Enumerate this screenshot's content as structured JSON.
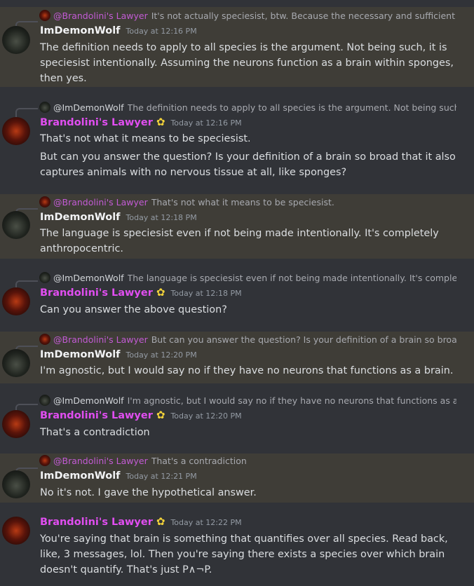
{
  "messages": [
    {
      "author": "ImDemonWolf",
      "time": "Today at 12:16 PM",
      "reply": {
        "name": "@Brandolini's Lawyer",
        "text": "It's not actually speciesist, btw. Because the necessary and sufficient cond"
      },
      "paragraphs": [
        "The definition needs to apply to all species is the argument. Not being such, it is speciesist intentionally. Assuming the neurons function as a brain within sponges, then yes."
      ]
    },
    {
      "author": "Brandolini's Lawyer",
      "time": "Today at 12:16 PM",
      "reply": {
        "name": "@ImDemonWolf",
        "text": "The definition needs to apply to all species is the argument. Not being such, it is"
      },
      "paragraphs": [
        "That's not what it means to be speciesist.",
        "But can you answer the question? Is your definition of a brain so broad that it also captures animals with no nervous tissue at all, like sponges?"
      ]
    },
    {
      "author": "ImDemonWolf",
      "time": "Today at 12:18 PM",
      "reply": {
        "name": "@Brandolini's Lawyer",
        "text": "That's not what it means to be speciesist."
      },
      "paragraphs": [
        "The language is speciesist even if not being made intentionally. It's completely anthropocentric."
      ]
    },
    {
      "author": "Brandolini's Lawyer",
      "time": "Today at 12:18 PM",
      "reply": {
        "name": "@ImDemonWolf",
        "text": "The language is speciesist even if not being made intentionally. It's completely a"
      },
      "paragraphs": [
        "Can you answer the above question?"
      ]
    },
    {
      "author": "ImDemonWolf",
      "time": "Today at 12:20 PM",
      "reply": {
        "name": "@Brandolini's Lawyer",
        "text": "But can you answer the question? Is your definition of a brain so broad tha"
      },
      "paragraphs": [
        "I'm agnostic, but I would say no if they have no neurons that functions as a brain."
      ]
    },
    {
      "author": "Brandolini's Lawyer",
      "time": "Today at 12:20 PM",
      "reply": {
        "name": "@ImDemonWolf",
        "text": "I'm agnostic, but I would say no if they have no neurons that functions as a brain"
      },
      "paragraphs": [
        "That's a contradiction"
      ]
    },
    {
      "author": "ImDemonWolf",
      "time": "Today at 12:21 PM",
      "reply": {
        "name": "@Brandolini's Lawyer",
        "text": "That's a contradiction"
      },
      "paragraphs": [
        "No it's not. I gave the hypothetical answer."
      ]
    },
    {
      "author": "Brandolini's Lawyer",
      "time": "Today at 12:22 PM",
      "paragraphs": [
        "You're saying that brain is something that quantifies over all species. Read back, like, 3 messages, lol. Then you're saying there exists a species over which brain doesn't quantify. That's just P∧¬P."
      ]
    }
  ],
  "colors": {
    "background": "#313338",
    "highlight": "#3f3d37",
    "brandolini_name": "#e04ef0",
    "mention": "#c35bd5",
    "badge": "#f3d33a"
  },
  "icons": {
    "badge": "flower-badge-icon"
  }
}
